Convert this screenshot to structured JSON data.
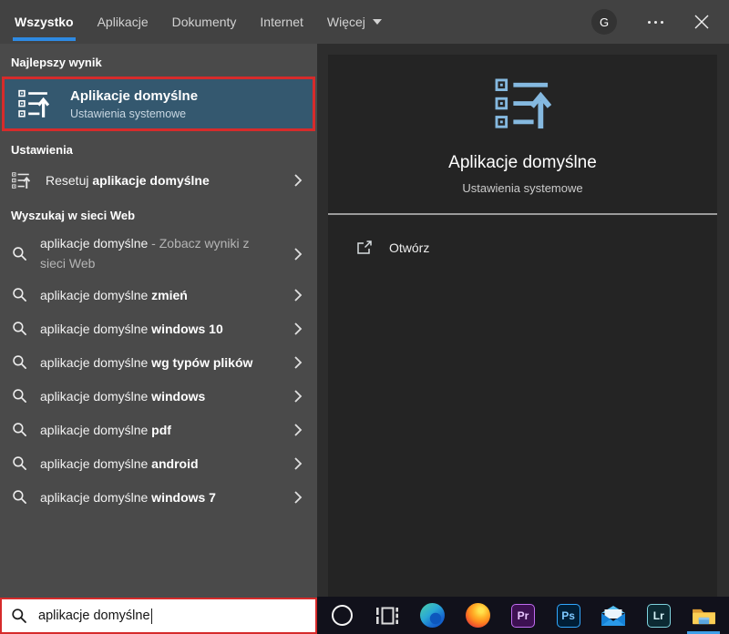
{
  "colors": {
    "accent_blue": "#2e8ae2",
    "highlight_blue": "#34586f",
    "attention_red": "#d62b2b",
    "icon_blue": "#85b9e0",
    "taskbar_indicator": "#3f9fe8"
  },
  "tabs": {
    "items": [
      {
        "id": "wszystko",
        "label": "Wszystko",
        "active": true
      },
      {
        "id": "aplikacje",
        "label": "Aplikacje"
      },
      {
        "id": "dokumenty",
        "label": "Dokumenty"
      },
      {
        "id": "internet",
        "label": "Internet"
      },
      {
        "id": "wiecej",
        "label": "Więcej",
        "dropdown": true
      }
    ]
  },
  "titlebar": {
    "avatar_letter": "G"
  },
  "left_panel": {
    "best_match_header": "Najlepszy wynik",
    "best_match": {
      "title": "Aplikacje domyślne",
      "subtitle": "Ustawienia systemowe"
    },
    "settings_header": "Ustawienia",
    "settings_item": {
      "regular": "Resetuj",
      "bold": "aplikacje domyślne"
    },
    "web_header": "Wyszukaj w sieci Web",
    "web_items": [
      {
        "base": "aplikacje domyślne",
        "sep": " - ",
        "suffix": "Zobacz wyniki z sieci Web",
        "muted": true
      },
      {
        "base": "aplikacje domyślne",
        "suffix": "zmień"
      },
      {
        "base": "aplikacje domyślne",
        "suffix": "windows 10"
      },
      {
        "base": "aplikacje domyślne",
        "suffix": "wg typów plików"
      },
      {
        "base": "aplikacje domyślne",
        "suffix": "windows"
      },
      {
        "base": "aplikacje domyślne",
        "suffix": "pdf"
      },
      {
        "base": "aplikacje domyślne",
        "suffix": "android"
      },
      {
        "base": "aplikacje domyślne",
        "suffix": "windows 7"
      }
    ]
  },
  "preview": {
    "title": "Aplikacje domyślne",
    "subtitle": "Ustawienia systemowe",
    "open_label": "Otwórz"
  },
  "search_box": {
    "value": "aplikacje domyślne"
  },
  "taskbar": {
    "items": [
      {
        "name": "cortana"
      },
      {
        "name": "task-view"
      },
      {
        "name": "edge"
      },
      {
        "name": "firefox"
      },
      {
        "name": "premiere",
        "label": "Pr"
      },
      {
        "name": "photoshop",
        "label": "Ps"
      },
      {
        "name": "mail"
      },
      {
        "name": "lightroom",
        "label": "Lr"
      },
      {
        "name": "file-explorer",
        "active": true
      }
    ]
  }
}
